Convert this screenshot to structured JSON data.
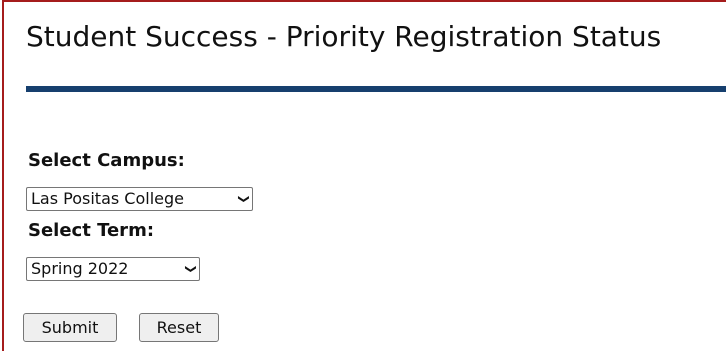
{
  "header": {
    "title": "Student Success - Priority Registration Status"
  },
  "form": {
    "campus": {
      "label": "Select Campus:",
      "selected": "Las Positas College"
    },
    "term": {
      "label": "Select Term:",
      "selected": "Spring 2022"
    },
    "submit_label": "Submit",
    "reset_label": "Reset"
  },
  "colors": {
    "accent_bar": "#163f6e",
    "frame_rule": "#a51c1c"
  },
  "icons": {
    "select_arrow": "chevron-down-icon"
  }
}
